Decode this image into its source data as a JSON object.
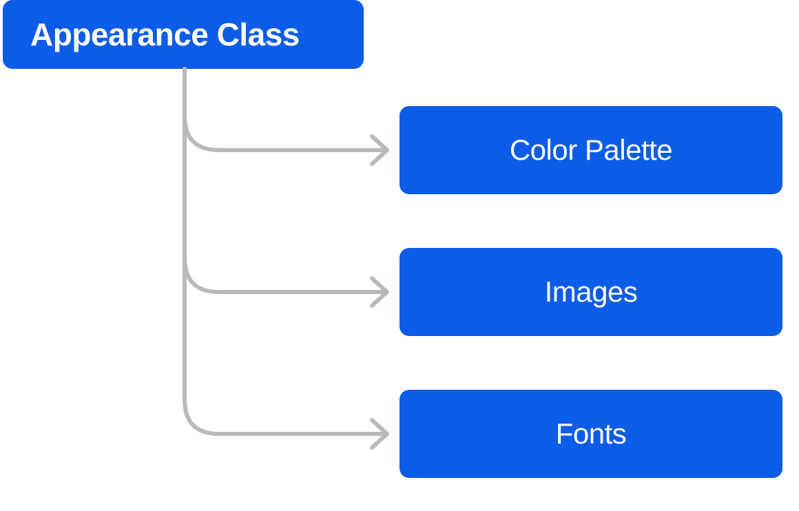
{
  "diagram": {
    "root": {
      "label": "Appearance Class"
    },
    "children": [
      {
        "label": "Color Palette"
      },
      {
        "label": "Images"
      },
      {
        "label": "Fonts"
      }
    ],
    "colors": {
      "box_fill": "#0B5CE8",
      "box_text": "#ffffff",
      "connector": "#B9B9B9"
    }
  }
}
